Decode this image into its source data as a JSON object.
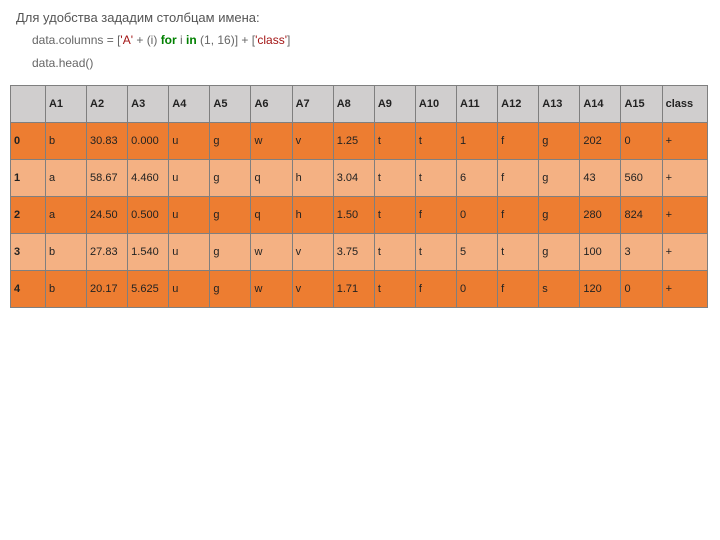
{
  "intro": "Для удобства зададим столбцам имена:",
  "code": {
    "l1": {
      "p1": "data.columns ",
      "eq": "=",
      "sp1": " [",
      "s1": "'A'",
      "plus1": " + ",
      "paren1": "(i) ",
      "kw_for": "for",
      "sp2": " i ",
      "kw_in": "in",
      "sp3": " (1, 16)] ",
      "plus2": "+ ",
      "br2": "[",
      "s2": "'class'",
      "br3": "]"
    },
    "l2": "data.head()"
  },
  "headers": [
    "",
    "A1",
    "A2",
    "A3",
    "A4",
    "A5",
    "A6",
    "A7",
    "A8",
    "A9",
    "A10",
    "A11",
    "A12",
    "A13",
    "A14",
    "A15",
    "class"
  ],
  "rows": [
    {
      "idx": "0",
      "cells": [
        "b",
        "30.83",
        "0.000",
        "u",
        "g",
        "w",
        "v",
        "1.25",
        "t",
        "t",
        "1",
        "f",
        "g",
        "202",
        "0",
        "+"
      ]
    },
    {
      "idx": "1",
      "cells": [
        "a",
        "58.67",
        "4.460",
        "u",
        "g",
        "q",
        "h",
        "3.04",
        "t",
        "t",
        "6",
        "f",
        "g",
        "43",
        "560",
        "+"
      ]
    },
    {
      "idx": "2",
      "cells": [
        "a",
        "24.50",
        "0.500",
        "u",
        "g",
        "q",
        "h",
        "1.50",
        "t",
        "f",
        "0",
        "f",
        "g",
        "280",
        "824",
        "+"
      ]
    },
    {
      "idx": "3",
      "cells": [
        "b",
        "27.83",
        "1.540",
        "u",
        "g",
        "w",
        "v",
        "3.75",
        "t",
        "t",
        "5",
        "t",
        "g",
        "100",
        "3",
        "+"
      ]
    },
    {
      "idx": "4",
      "cells": [
        "b",
        "20.17",
        "5.625",
        "u",
        "g",
        "w",
        "v",
        "1.71",
        "t",
        "f",
        "0",
        "f",
        "s",
        "120",
        "0",
        "+"
      ]
    }
  ]
}
